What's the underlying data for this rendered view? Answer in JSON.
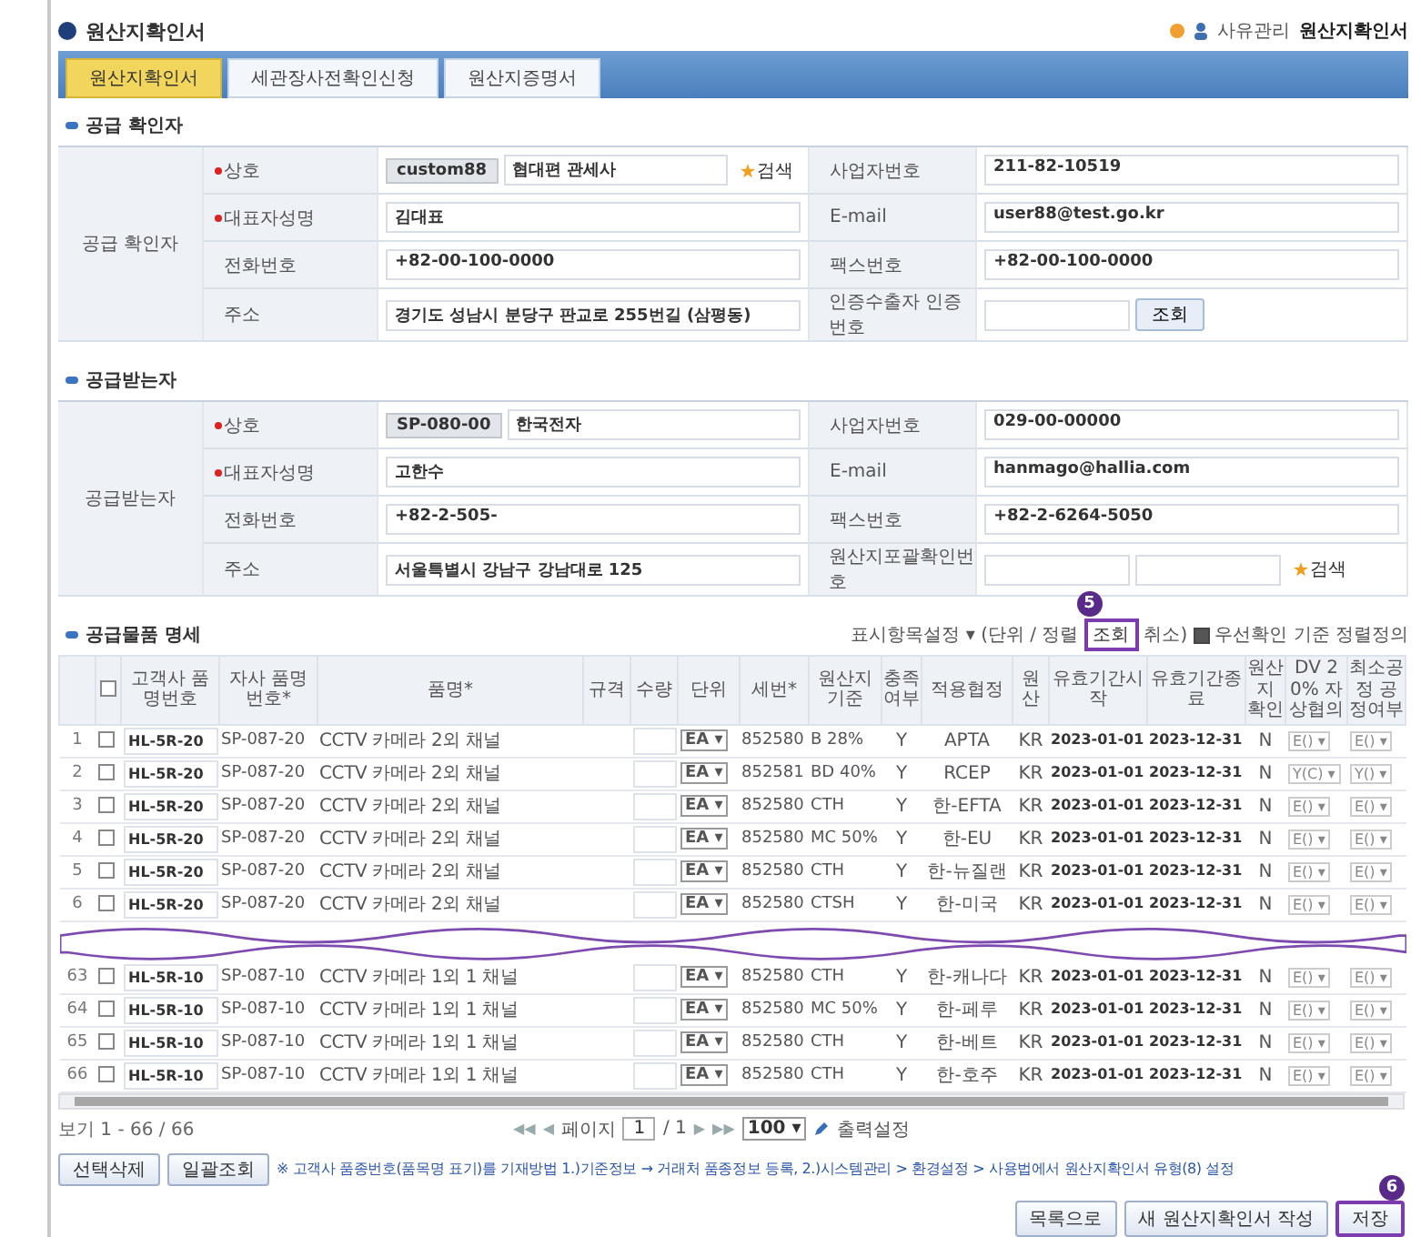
{
  "header": {
    "title": "원산지확인서",
    "breadcrumb": [
      "사유관리",
      "원산지확인서"
    ]
  },
  "tabs": [
    {
      "label": "원산지확인서",
      "selected": true
    },
    {
      "label": "세관장사전확인신청",
      "selected": false
    },
    {
      "label": "원산지증명서",
      "selected": false
    }
  ],
  "sections": [
    {
      "title": "공급 확인자",
      "group_label": "공급 확인자",
      "rows": [
        [
          {
            "label": "상호",
            "required": true,
            "fields": [
              {
                "kind": "code",
                "value": "custom88"
              },
              {
                "kind": "input",
                "value": "협대편 관세사"
              }
            ],
            "button": {
              "kind": "search",
              "label": "검색"
            }
          },
          {
            "label": "사업자번호",
            "required": false,
            "fields": [
              {
                "kind": "input",
                "value": "211-82-10519"
              }
            ]
          }
        ],
        [
          {
            "label": "대표자성명",
            "required": true,
            "fields": [
              {
                "kind": "input",
                "value": "김대표"
              }
            ]
          },
          {
            "label": "E-mail",
            "required": false,
            "fields": [
              {
                "kind": "input",
                "value": "user88@test.go.kr"
              }
            ]
          }
        ],
        [
          {
            "label": "전화번호",
            "required": false,
            "fields": [
              {
                "kind": "input",
                "value": "+82-00-100-0000"
              }
            ]
          },
          {
            "label": "팩스번호",
            "required": false,
            "fields": [
              {
                "kind": "input",
                "value": "+82-00-100-0000"
              }
            ]
          }
        ],
        [
          {
            "label": "주소",
            "required": false,
            "fields": [
              {
                "kind": "input",
                "value": "경기도 성남시 분당구 판교로 255번길 (삼평동)"
              }
            ]
          },
          {
            "label": "인증수출자 인증번호",
            "required": false,
            "fields": [
              {
                "kind": "short"
              }
            ],
            "button": {
              "kind": "plain",
              "label": "조회"
            }
          }
        ]
      ]
    },
    {
      "title": "공급받는자",
      "group_label": "공급받는자",
      "rows": [
        [
          {
            "label": "상호",
            "required": true,
            "fields": [
              {
                "kind": "code",
                "value": "SP-080-00"
              },
              {
                "kind": "input",
                "value": "한국전자"
              }
            ]
          },
          {
            "label": "사업자번호",
            "required": false,
            "fields": [
              {
                "kind": "input",
                "value": "029-00-00000"
              }
            ]
          }
        ],
        [
          {
            "label": "대표자성명",
            "required": true,
            "fields": [
              {
                "kind": "input",
                "value": "고한수"
              }
            ]
          },
          {
            "label": "E-mail",
            "required": false,
            "fields": [
              {
                "kind": "input",
                "value": "hanmago@hallia.com"
              }
            ]
          }
        ],
        [
          {
            "label": "전화번호",
            "required": false,
            "fields": [
              {
                "kind": "input",
                "value": "+82-2-505-"
              }
            ]
          },
          {
            "label": "팩스번호",
            "required": false,
            "fields": [
              {
                "kind": "input",
                "value": "+82-2-6264-5050"
              }
            ]
          }
        ],
        [
          {
            "label": "주소",
            "required": false,
            "fields": [
              {
                "kind": "input",
                "value": "서울특별시 강남구 강남대로 125"
              }
            ]
          },
          {
            "label": "원산지포괄확인번호",
            "required": false,
            "fields": [
              {
                "kind": "short"
              },
              {
                "kind": "short"
              }
            ],
            "button": {
              "kind": "search",
              "label": "검색"
            }
          }
        ]
      ]
    }
  ],
  "products": {
    "title": "공급물품 명세",
    "toolbar": {
      "prefix": "표시항목설정 ▾ (단위 / 정렬",
      "button": "조회",
      "step": "5",
      "suffix": "취소)",
      "option": {
        "label": "우선확인 기준 정렬정의",
        "checked": true
      }
    },
    "columns": [
      "",
      "",
      "고객사 품명번호",
      "자사 품명번호*",
      "품명*",
      "규격",
      "수량",
      "단위",
      "세번*",
      "원산지기준",
      "충족여부",
      "적용협정",
      "원산",
      "유효기간시작",
      "유효기간종료",
      "원산지 확인",
      "DV 20% 자상협의",
      "최소공정 공정여부"
    ],
    "select_all": false,
    "rows": [
      {
        "kind": "row",
        "no": "1",
        "checked": false,
        "item_code": "HL-5R-20",
        "own_code": "SP-087-20",
        "name": "CCTV 카메라 2외 채널",
        "unit": "EA ▾",
        "hs": "852580",
        "criterion": "B 28%",
        "met": "Y",
        "agreement": "APTA",
        "origin": "KR",
        "start": "2023-01-01",
        "end": "2023-12-31",
        "confirmed": "N",
        "col_17": "E() ▾",
        "col_18": "E() ▾"
      },
      {
        "kind": "row",
        "no": "2",
        "checked": false,
        "item_code": "HL-5R-20",
        "own_code": "SP-087-20",
        "name": "CCTV 카메라 2외 채널",
        "unit": "EA ▾",
        "hs": "852581",
        "criterion": "BD 40%",
        "met": "Y",
        "agreement": "RCEP",
        "origin": "KR",
        "start": "2023-01-01",
        "end": "2023-12-31",
        "confirmed": "N",
        "col_17": "Y(C) ▾",
        "col_18": "Y() ▾"
      },
      {
        "kind": "row",
        "no": "3",
        "checked": false,
        "item_code": "HL-5R-20",
        "own_code": "SP-087-20",
        "name": "CCTV 카메라 2외 채널",
        "unit": "EA ▾",
        "hs": "852580",
        "criterion": "CTH",
        "met": "Y",
        "agreement": "한-EFTA",
        "origin": "KR",
        "start": "2023-01-01",
        "end": "2023-12-31",
        "confirmed": "N",
        "col_17": "E() ▾",
        "col_18": "E() ▾"
      },
      {
        "kind": "row",
        "no": "4",
        "checked": false,
        "item_code": "HL-5R-20",
        "own_code": "SP-087-20",
        "name": "CCTV 카메라 2외 채널",
        "unit": "EA ▾",
        "hs": "852580",
        "criterion": "MC 50%",
        "met": "Y",
        "agreement": "한-EU",
        "origin": "KR",
        "start": "2023-01-01",
        "end": "2023-12-31",
        "confirmed": "N",
        "col_17": "E() ▾",
        "col_18": "E() ▾"
      },
      {
        "kind": "row",
        "no": "5",
        "checked": false,
        "item_code": "HL-5R-20",
        "own_code": "SP-087-20",
        "name": "CCTV 카메라 2외 채널",
        "unit": "EA ▾",
        "hs": "852580",
        "criterion": "CTH",
        "met": "Y",
        "agreement": "한-뉴질랜",
        "origin": "KR",
        "start": "2023-01-01",
        "end": "2023-12-31",
        "confirmed": "N",
        "col_17": "E() ▾",
        "col_18": "E() ▾"
      },
      {
        "kind": "row",
        "no": "6",
        "checked": false,
        "item_code": "HL-5R-20",
        "own_code": "SP-087-20",
        "name": "CCTV 카메라 2외 채널",
        "unit": "EA ▾",
        "hs": "852580",
        "criterion": "CTSH",
        "met": "Y",
        "agreement": "한-미국",
        "origin": "KR",
        "start": "2023-01-01",
        "end": "2023-12-31",
        "confirmed": "N",
        "col_17": "E() ▾",
        "col_18": "E() ▾"
      },
      {
        "kind": "break"
      },
      {
        "kind": "row",
        "no": "63",
        "checked": false,
        "item_code": "HL-5R-10",
        "own_code": "SP-087-10",
        "name": "CCTV 카메라 1외 1 채널",
        "unit": "EA ▾",
        "hs": "852580",
        "criterion": "CTH",
        "met": "Y",
        "agreement": "한-캐나다",
        "origin": "KR",
        "start": "2023-01-01",
        "end": "2023-12-31",
        "confirmed": "N",
        "col_17": "E() ▾",
        "col_18": "E() ▾"
      },
      {
        "kind": "row",
        "no": "64",
        "checked": false,
        "item_code": "HL-5R-10",
        "own_code": "SP-087-10",
        "name": "CCTV 카메라 1외 1 채널",
        "unit": "EA ▾",
        "hs": "852580",
        "criterion": "MC 50%",
        "met": "Y",
        "agreement": "한-페루",
        "origin": "KR",
        "start": "2023-01-01",
        "end": "2023-12-31",
        "confirmed": "N",
        "col_17": "E() ▾",
        "col_18": "E() ▾"
      },
      {
        "kind": "row",
        "no": "65",
        "checked": false,
        "item_code": "HL-5R-10",
        "own_code": "SP-087-10",
        "name": "CCTV 카메라 1외 1 채널",
        "unit": "EA ▾",
        "hs": "852580",
        "criterion": "CTH",
        "met": "Y",
        "agreement": "한-베트",
        "origin": "KR",
        "start": "2023-01-01",
        "end": "2023-12-31",
        "confirmed": "N",
        "col_17": "E() ▾",
        "col_18": "E() ▾"
      },
      {
        "kind": "row",
        "no": "66",
        "checked": false,
        "item_code": "HL-5R-10",
        "own_code": "SP-087-10",
        "name": "CCTV 카메라 1외 1 채널",
        "unit": "EA ▾",
        "hs": "852580",
        "criterion": "CTH",
        "met": "Y",
        "agreement": "한-호주",
        "origin": "KR",
        "start": "2023-01-01",
        "end": "2023-12-31",
        "confirmed": "N",
        "col_17": "E() ▾",
        "col_18": "E() ▾"
      }
    ],
    "count": "보기 1 - 66 / 66",
    "pager": {
      "first": "◀◀",
      "prev": "◀",
      "label": "페이지",
      "page": "1",
      "total": "/ 1",
      "next": "▶",
      "last": "▶▶",
      "size": "100 ▾",
      "print": "출력설정"
    }
  },
  "actions": {
    "left": [
      "선택삭제",
      "일괄조회"
    ],
    "note": "※ 고객사 품종번호(품목명 표기)를 기재방법 1.)기준정보 → 거래처 품종정보 등록, 2.)시스템관리 > 환경설정 > 사용법에서 원산지확인서 유형(8) 설정",
    "right": [
      "목록으로",
      "새 원산지확인서 작성"
    ],
    "save": {
      "label": "저장",
      "step": "6"
    }
  }
}
